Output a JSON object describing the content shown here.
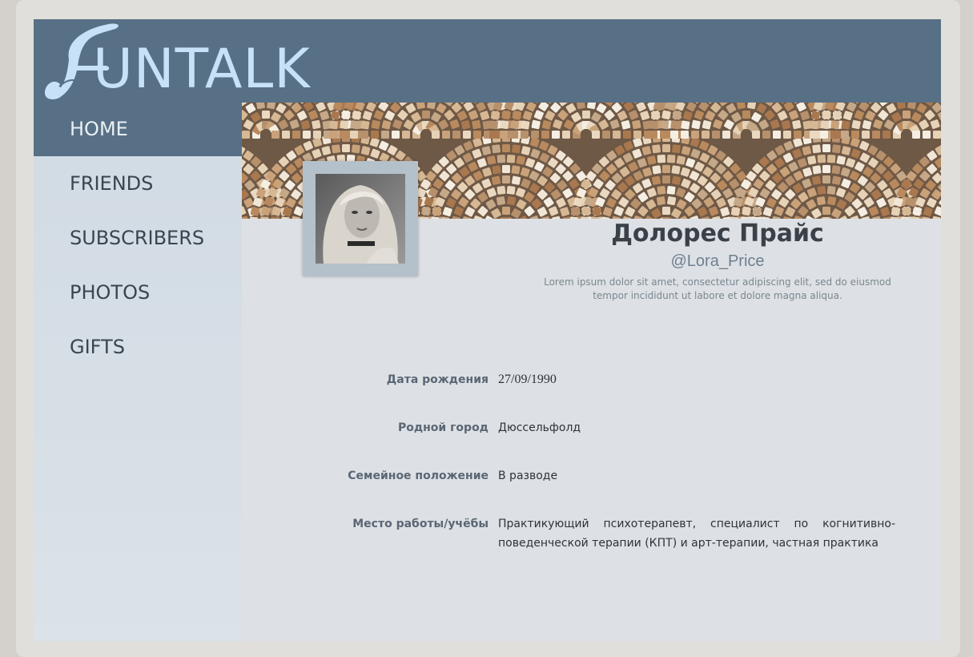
{
  "app": {
    "logo_text": "UNTALK",
    "logo_mark": "F"
  },
  "sidebar": {
    "items": [
      {
        "label": "HOME",
        "active": true
      },
      {
        "label": "FRIENDS",
        "active": false
      },
      {
        "label": "SUBSCRIBERS",
        "active": false
      },
      {
        "label": "PHOTOS",
        "active": false
      },
      {
        "label": "GIFTS",
        "active": false
      }
    ]
  },
  "profile": {
    "name": "Долорес Прайс",
    "handle": "@Lora_Price",
    "bio": "Lorem ipsum dolor sit amet, consectetur adipiscing elit, sed do eiusmod tempor incididunt ut labore et dolore magna aliqua.",
    "info": [
      {
        "label": "Дата рождения",
        "value": "27/09/1990"
      },
      {
        "label": "Родной город",
        "value": "Дюссельфолд"
      },
      {
        "label": "Семейное положение",
        "value": "В разводе"
      },
      {
        "label": "Место работы/учёбы",
        "value": "Практикующий психотерапевт, специалист по когнитивно-поведенческой терапии (КПТ) и арт-терапии, частная практика"
      }
    ]
  },
  "colors": {
    "header": "#587086",
    "logo": "#c7e1f8",
    "sidebar": "#d1dbe4",
    "main": "#dde1e5"
  },
  "icons": {
    "logo": "funtalk-logo-icon"
  }
}
